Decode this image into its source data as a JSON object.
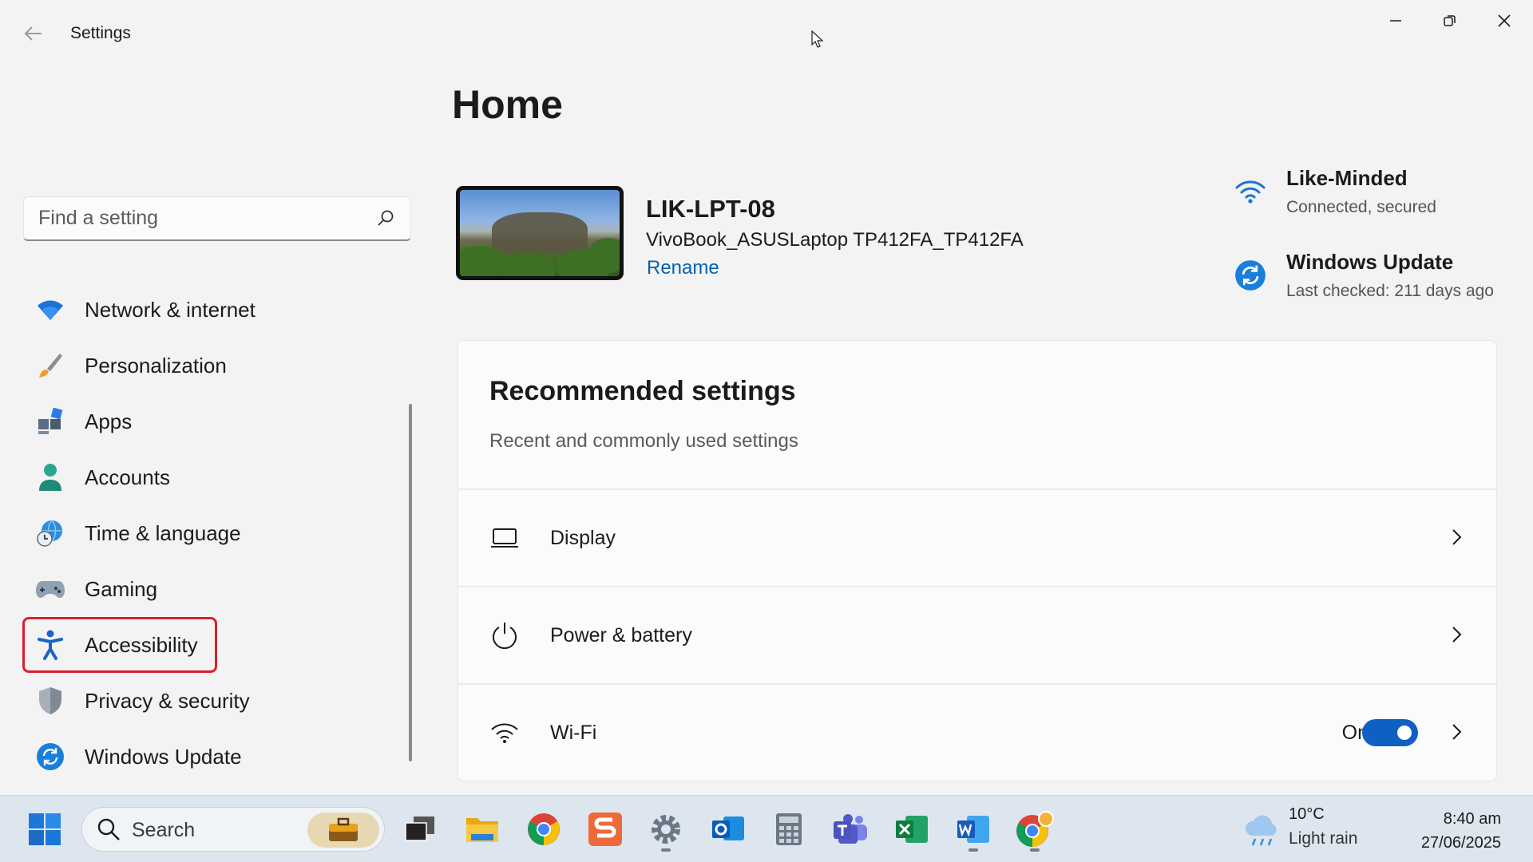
{
  "app": {
    "title": "Settings"
  },
  "search": {
    "placeholder": "Find a setting"
  },
  "sidebar": {
    "items": [
      {
        "label": "Network & internet",
        "icon": "wifi-icon"
      },
      {
        "label": "Personalization",
        "icon": "brush-icon"
      },
      {
        "label": "Apps",
        "icon": "apps-icon"
      },
      {
        "label": "Accounts",
        "icon": "person-icon"
      },
      {
        "label": "Time & language",
        "icon": "globe-clock-icon"
      },
      {
        "label": "Gaming",
        "icon": "gamepad-icon"
      },
      {
        "label": "Accessibility",
        "icon": "accessibility-icon",
        "highlighted": true
      },
      {
        "label": "Privacy & security",
        "icon": "shield-icon"
      },
      {
        "label": "Windows Update",
        "icon": "update-icon"
      }
    ]
  },
  "home": {
    "title": "Home",
    "device": {
      "name": "LIK-LPT-08",
      "model": "VivoBook_ASUSLaptop TP412FA_TP412FA",
      "rename_label": "Rename"
    },
    "status": [
      {
        "title": "Like-Minded",
        "subtitle": "Connected, secured",
        "icon": "wifi-icon"
      },
      {
        "title": "Windows Update",
        "subtitle": "Last checked: 211 days ago",
        "icon": "update-icon"
      }
    ],
    "recommended": {
      "title": "Recommended settings",
      "subtitle": "Recent and commonly used settings",
      "rows": [
        {
          "label": "Display",
          "icon": "laptop-icon"
        },
        {
          "label": "Power & battery",
          "icon": "power-icon"
        },
        {
          "label": "Wi-Fi",
          "icon": "wifi-icon",
          "state": "On",
          "toggle_on": true
        }
      ]
    }
  },
  "taskbar": {
    "search_label": "Search",
    "weather": {
      "temp": "10°C",
      "condition": "Light rain"
    },
    "clock": {
      "time": "8:40 am",
      "date": "27/06/2025"
    }
  },
  "colors": {
    "accent": "#1060c4",
    "link": "#0063b1",
    "highlight": "#d9202d"
  }
}
